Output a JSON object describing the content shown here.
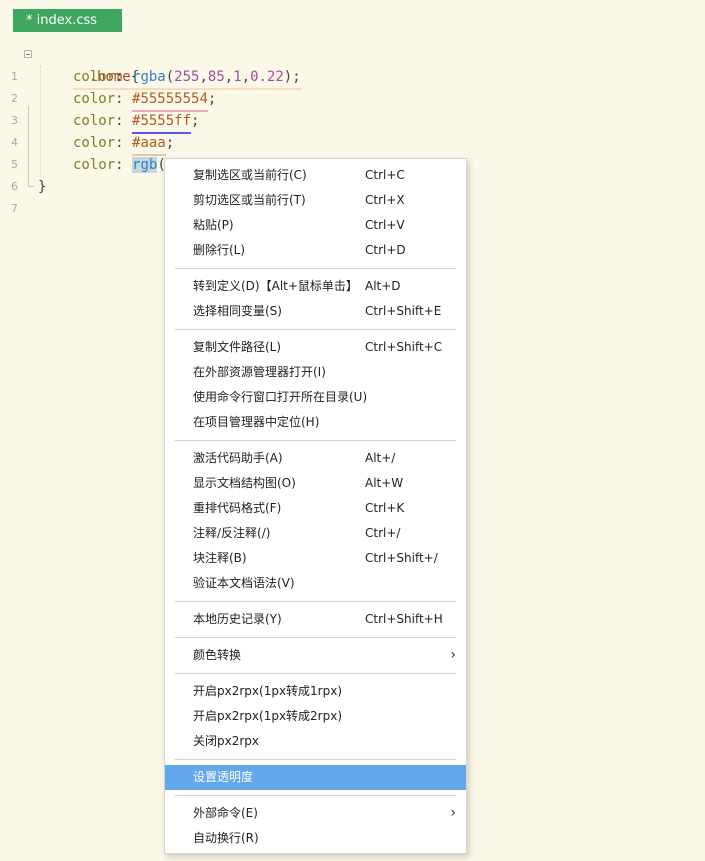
{
  "tab": {
    "title": "* index.css"
  },
  "editor": {
    "lines": [
      {
        "num": "1",
        "tokens": [
          ".home",
          "{"
        ]
      },
      {
        "num": "2",
        "tokens": [
          "color",
          ": ",
          "rgba",
          "(",
          "255",
          ",",
          "85",
          ",",
          "1",
          ",",
          "0.22",
          ");"
        ]
      },
      {
        "num": "3",
        "tokens": [
          "color",
          ": ",
          "#55555554",
          ";"
        ]
      },
      {
        "num": "4",
        "tokens": [
          "color",
          ": ",
          "#5555ff",
          ";"
        ]
      },
      {
        "num": "5",
        "tokens": [
          "color",
          ": ",
          "#aaa",
          ";"
        ]
      },
      {
        "num": "6",
        "tokens": [
          "color",
          ": ",
          "rgb",
          "("
        ]
      },
      {
        "num": "7",
        "tokens": [
          "}"
        ]
      }
    ]
  },
  "colors": {
    "line2_underline": "#fcd8c6",
    "line3_underline": "#e8a8b8",
    "line4_underline": "#5555ff",
    "line5_underline": "#d8cfa8",
    "menu_active": "#62a7e8"
  },
  "context_menu": {
    "groups": [
      [
        {
          "label": "复制选区或当前行(C)",
          "shortcut": "Ctrl+C"
        },
        {
          "label": "剪切选区或当前行(T)",
          "shortcut": "Ctrl+X"
        },
        {
          "label": "粘贴(P)",
          "shortcut": "Ctrl+V"
        },
        {
          "label": "删除行(L)",
          "shortcut": "Ctrl+D"
        }
      ],
      [
        {
          "label": "转到定义(D)【Alt+鼠标单击】",
          "shortcut": "Alt+D"
        },
        {
          "label": "选择相同变量(S)",
          "shortcut": "Ctrl+Shift+E"
        }
      ],
      [
        {
          "label": "复制文件路径(L)",
          "shortcut": "Ctrl+Shift+C"
        },
        {
          "label": "在外部资源管理器打开(I)",
          "shortcut": ""
        },
        {
          "label": "使用命令行窗口打开所在目录(U)",
          "shortcut": ""
        },
        {
          "label": "在项目管理器中定位(H)",
          "shortcut": ""
        }
      ],
      [
        {
          "label": "激活代码助手(A)",
          "shortcut": "Alt+/"
        },
        {
          "label": "显示文档结构图(O)",
          "shortcut": "Alt+W"
        },
        {
          "label": "重排代码格式(F)",
          "shortcut": "Ctrl+K"
        },
        {
          "label": "注释/反注释(/)",
          "shortcut": "Ctrl+/"
        },
        {
          "label": "块注释(B)",
          "shortcut": "Ctrl+Shift+/"
        },
        {
          "label": "验证本文档语法(V)",
          "shortcut": ""
        }
      ],
      [
        {
          "label": "本地历史记录(Y)",
          "shortcut": "Ctrl+Shift+H"
        }
      ],
      [
        {
          "label": "颜色转换",
          "shortcut": "",
          "submenu": true
        }
      ],
      [
        {
          "label": "开启px2rpx(1px转成1rpx)",
          "shortcut": ""
        },
        {
          "label": "开启px2rpx(1px转成2rpx)",
          "shortcut": ""
        },
        {
          "label": "关闭px2rpx",
          "shortcut": ""
        }
      ],
      [
        {
          "label": "设置透明度",
          "shortcut": "",
          "active": true
        }
      ],
      [
        {
          "label": "外部命令(E)",
          "shortcut": "",
          "submenu": true
        },
        {
          "label": "自动换行(R)",
          "shortcut": ""
        }
      ]
    ]
  }
}
